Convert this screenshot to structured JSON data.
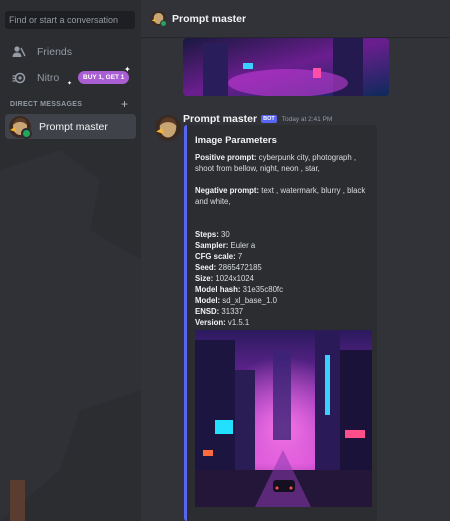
{
  "sidebar": {
    "search_placeholder": "Find or start a conversation",
    "friends_label": "Friends",
    "nitro_label": "Nitro",
    "nitro_badge": "BUY 1, GET 1",
    "dm_header": "DIRECT MESSAGES",
    "dm_add": "+",
    "active_dm": "Prompt master"
  },
  "topbar": {
    "title": "Prompt master"
  },
  "message": {
    "author": "Prompt master",
    "bot_tag": "BOT",
    "timestamp": "Today at 2:41 PM",
    "embed": {
      "title": "Image Parameters",
      "positive_label": "Positive prompt:",
      "positive_value": " cyberpunk city, photograph , shoot from bellow, night, neon , star,",
      "negative_label": "Negative prompt:",
      "negative_value": " text , watermark, blurry , black and white,",
      "params": [
        {
          "label": "Steps:",
          "value": " 30"
        },
        {
          "label": "Sampler:",
          "value": " Euler a"
        },
        {
          "label": "CFG scale:",
          "value": " 7"
        },
        {
          "label": "Seed:",
          "value": " 2865472185"
        },
        {
          "label": "Size:",
          "value": " 1024x1024"
        },
        {
          "label": "Model hash:",
          "value": " 31e35c80fc"
        },
        {
          "label": "Model:",
          "value": " sd_xl_base_1.0"
        },
        {
          "label": "ENSD:",
          "value": " 31337"
        },
        {
          "label": "Version:",
          "value": " v1.5.1"
        }
      ]
    }
  },
  "colors": {
    "accent": "#5865f2",
    "online": "#23a55a",
    "nitro": "#a95fd3"
  },
  "icons": [
    "friends-icon",
    "nitro-icon",
    "plus-icon",
    "sparkle-icon"
  ]
}
